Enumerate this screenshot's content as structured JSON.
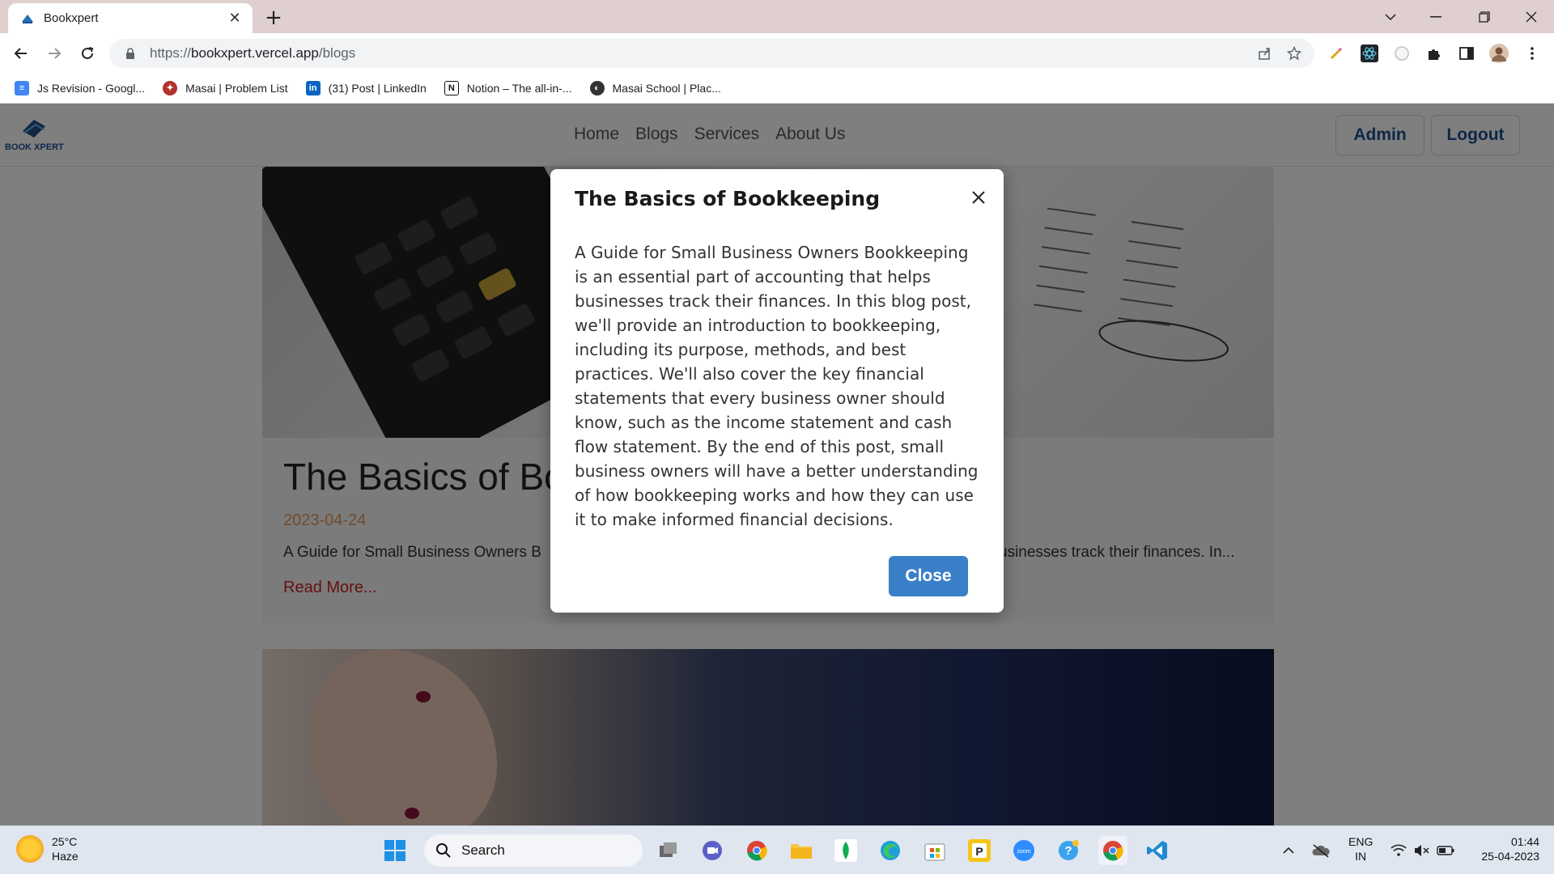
{
  "browser": {
    "tab": {
      "title": "Bookxpert"
    },
    "url": {
      "prefix": "https://",
      "host": "bookxpert.vercel.app",
      "path": "/blogs"
    },
    "bookmarks": [
      {
        "label": "Js Revision - Googl...",
        "icon": "google-docs-icon",
        "color": "#4285f4"
      },
      {
        "label": "Masai | Problem List",
        "icon": "masai-icon",
        "color": "#b3312b"
      },
      {
        "label": "(31) Post | LinkedIn",
        "icon": "linkedin-icon",
        "color": "#0a66c2"
      },
      {
        "label": "Notion – The all-in-...",
        "icon": "notion-icon",
        "color": "#111111"
      },
      {
        "label": "Masai School | Plac...",
        "icon": "globe-icon",
        "color": "#333333"
      }
    ]
  },
  "site": {
    "nav": [
      "Home",
      "Blogs",
      "Services",
      "About Us"
    ],
    "admin_label": "Admin",
    "logout_label": "Logout",
    "logo_text": "BOOK XPERT"
  },
  "blog": {
    "title_visible": "The Basics of Bo",
    "date": "2023-04-24",
    "excerpt_left": "A Guide for Small Business Owners B",
    "excerpt_right": "usinesses track their finances. In...",
    "read_more": "Read More..."
  },
  "modal": {
    "title": "The Basics of Bookkeeping",
    "body": "A Guide for Small Business Owners Bookkeeping is an essential part of accounting that helps businesses track their finances. In this blog post, we'll provide an introduction to bookkeeping, including its purpose, methods, and best practices. We'll also cover the key financial statements that every business owner should know, such as the income statement and cash flow statement. By the end of this post, small business owners will have a better understanding of how bookkeeping works and how they can use it to make informed financial decisions.",
    "close_label": "Close"
  },
  "taskbar": {
    "temp": "25°C",
    "weather": "Haze",
    "search_label": "Search",
    "lang_top": "ENG",
    "lang_bottom": "IN",
    "time": "01:44",
    "date": "25-04-2023"
  },
  "colors": {
    "accent_blue": "#3a80c9",
    "date_orange": "#e0975a",
    "readmore_red": "#cc2222"
  }
}
